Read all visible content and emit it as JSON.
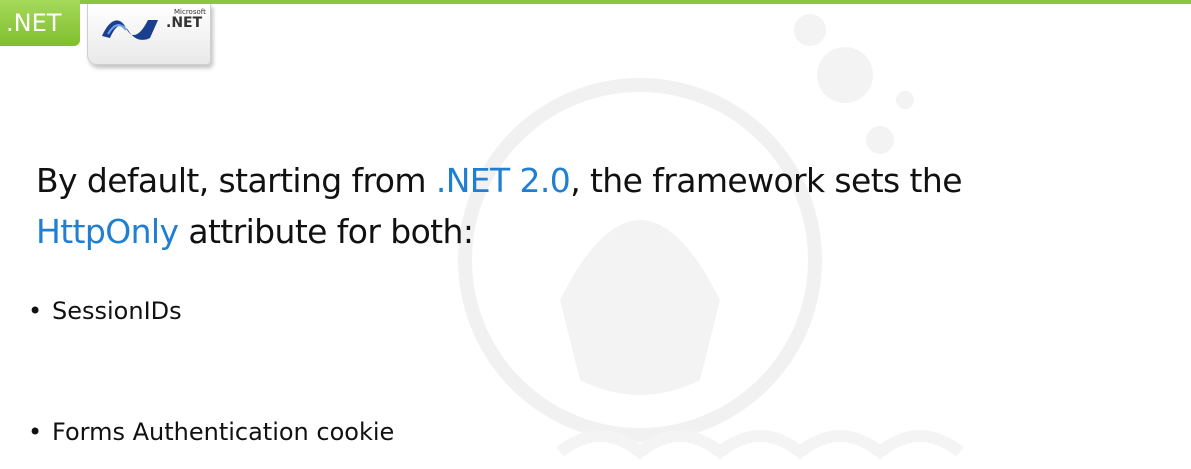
{
  "header": {
    "tab_label": ".NET",
    "logo": {
      "microsoft_text": "Microsoft",
      "net_text": ".NET"
    }
  },
  "main": {
    "para_parts": [
      {
        "text": "By default, starting from ",
        "highlight": false
      },
      {
        "text": ".NET 2.0",
        "highlight": true
      },
      {
        "text": ", the framework sets the ",
        "highlight": false
      },
      {
        "text": "HttpOnly",
        "highlight": true
      },
      {
        "text": " attribute for both:",
        "highlight": false
      }
    ],
    "bullets": [
      "SessionIDs",
      "Forms Authentication cookie"
    ]
  },
  "colors": {
    "accent_green": "#8cc63f",
    "highlight_blue": "#1f7fd0",
    "text": "#111111"
  }
}
